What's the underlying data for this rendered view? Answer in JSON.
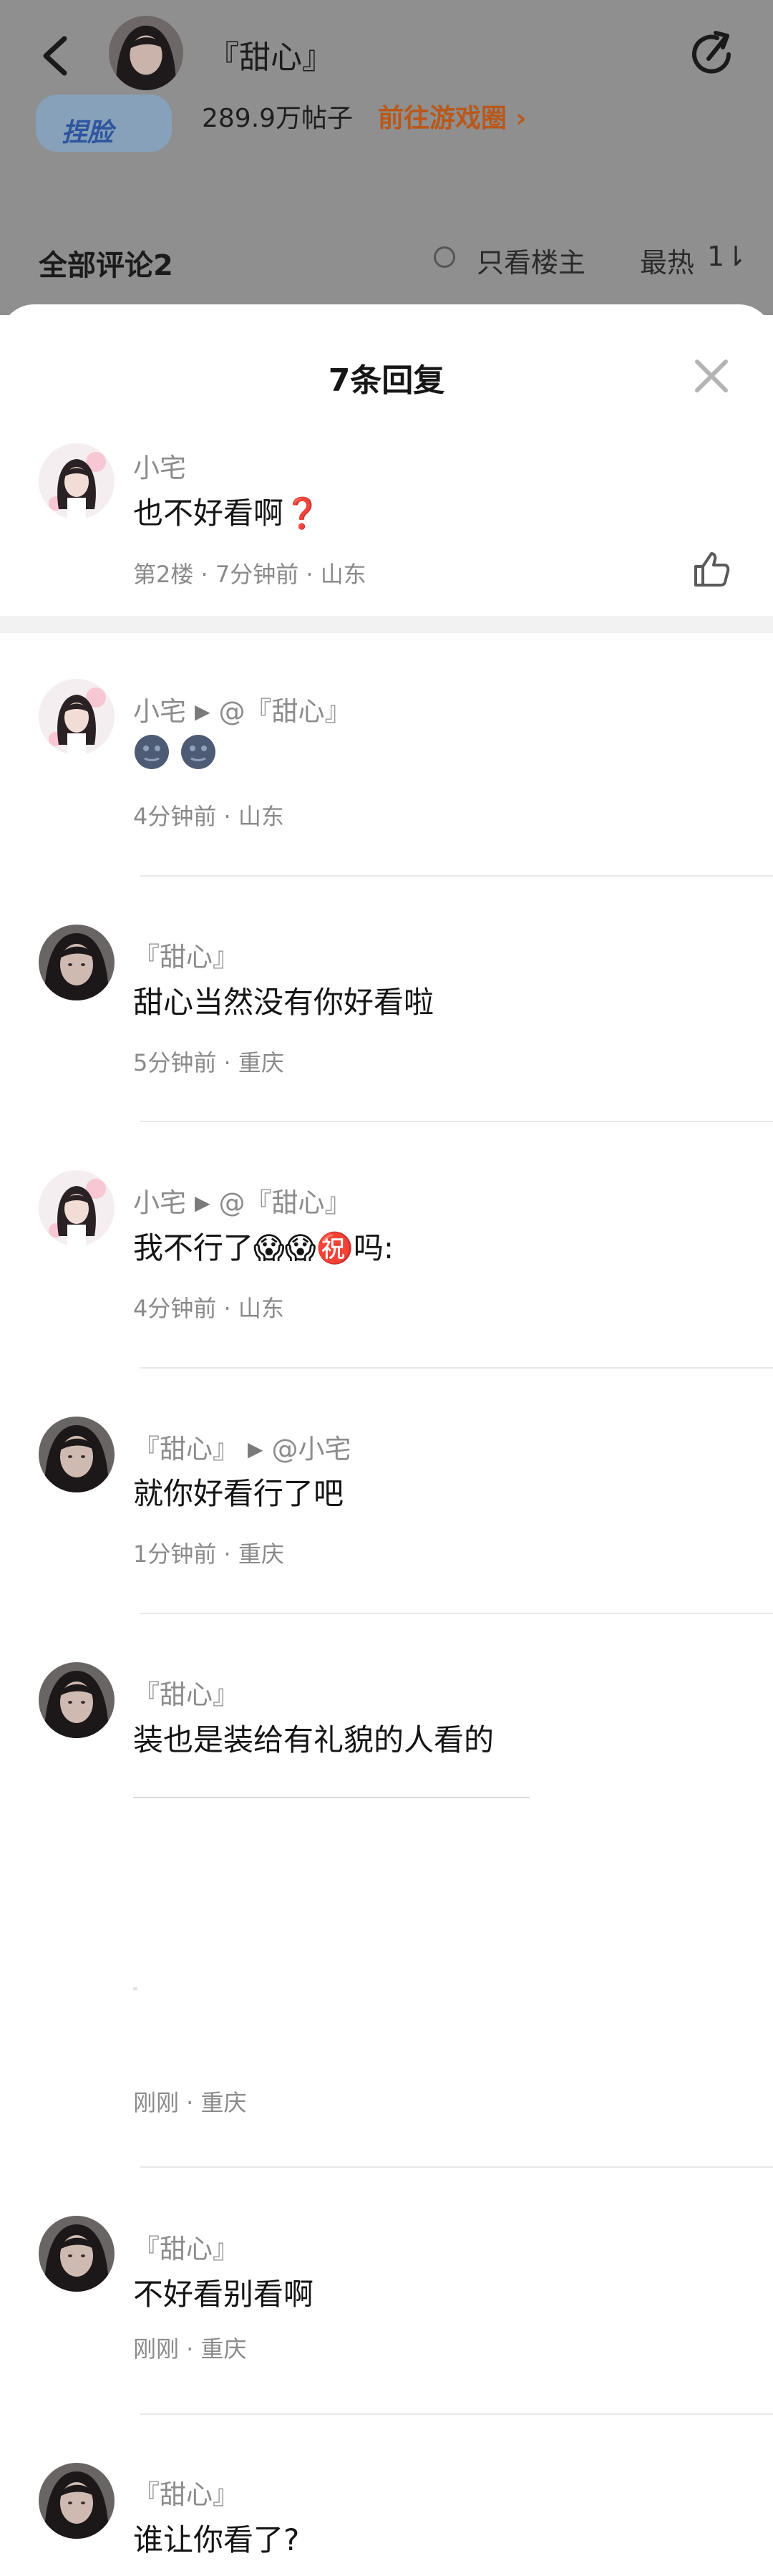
{
  "header": {
    "title": "『甜心』",
    "back_icon": "chevron-left-icon",
    "share_icon": "share-arrow-icon"
  },
  "background": {
    "game_logo_text": "捏脸",
    "game_posts": "289.9万帖子",
    "game_link": "前往游戏圈 ›",
    "all_comments": "全部评论2",
    "only_op": "只看楼主",
    "sort": "最热",
    "sort_icon": "1⇂"
  },
  "sheet": {
    "title": "7条回复",
    "close_icon": "close-icon",
    "main_comment": {
      "author": "小宅",
      "text": "也不好看啊❓",
      "meta": "第2楼 · 7分钟前 · 山东",
      "like_icon": "thumbs-up-icon"
    },
    "replies": [
      {
        "author": "小宅",
        "target": "@『甜心』",
        "text": "🌚🌚",
        "meta": "4分钟前 · 山东",
        "avatar": "xiaozhai"
      },
      {
        "author": "『甜心』",
        "target": "",
        "text": "甜心当然没有你好看啦",
        "meta": "5分钟前 · 重庆",
        "avatar": "tianxin"
      },
      {
        "author": "小宅",
        "target": "@『甜心』",
        "text": "我不行了😱😱㊗️吗:",
        "meta": "4分钟前 · 山东",
        "avatar": "xiaozhai"
      },
      {
        "author": "『甜心』",
        "target": "@小宅",
        "text": "就你好看行了吧",
        "meta": "1分钟前 · 重庆",
        "avatar": "tianxin"
      },
      {
        "author": "『甜心』",
        "target": "",
        "text": "装也是装给有礼貌的人看的",
        "meta": "刚刚 · 重庆",
        "avatar": "tianxin"
      },
      {
        "author": "『甜心』",
        "target": "",
        "text": "不好看别看啊",
        "meta": "刚刚 · 重庆",
        "avatar": "tianxin"
      },
      {
        "author": "『甜心』",
        "target": "",
        "text": "谁让你看了?",
        "meta": "",
        "avatar": "tianxin"
      }
    ]
  },
  "colors": {
    "dim_overlay": "#8f8f8f",
    "text_primary": "#151515",
    "text_secondary": "#8a8a8a",
    "link_orange": "#b8581b"
  }
}
